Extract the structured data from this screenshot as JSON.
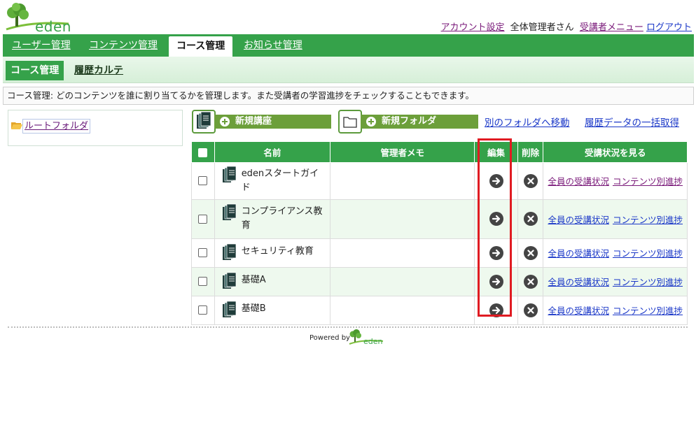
{
  "header": {
    "logo_text": "eden",
    "account_settings": "アカウント設定",
    "user_name": "全体管理者さん",
    "learner_menu": "受講者メニュー",
    "logout": "ログアウト"
  },
  "main_tabs": [
    {
      "label": "ユーザー管理"
    },
    {
      "label": "コンテンツ管理"
    },
    {
      "label": "コース管理"
    },
    {
      "label": "お知らせ管理"
    }
  ],
  "sub_tabs": {
    "active": "コース管理",
    "history": "履歴カルテ"
  },
  "description": "コース管理: どのコンテンツを誰に割り当てるかを管理します。また受講者の学習進捗をチェックすることもできます。",
  "folder_tree": {
    "root_label": "ルートフォルダ"
  },
  "toolbar": {
    "new_course": "新規講座",
    "new_folder": "新規フォルダ",
    "move_folder": "別のフォルダへ移動",
    "history_bulk": "履歴データの一括取得"
  },
  "table": {
    "headers": {
      "name": "名前",
      "memo": "管理者メモ",
      "edit": "編集",
      "delete": "削除",
      "status": "受講状況を見る"
    },
    "rows": [
      {
        "name": "edenスタートガイド",
        "memo": "",
        "all_status": "全員の受講状況",
        "content_progress": "コンテンツ別進捗"
      },
      {
        "name": "コンプライアンス教育",
        "memo": "",
        "all_status": "全員の受講状況",
        "content_progress": "コンテンツ別進捗"
      },
      {
        "name": "セキュリティ教育",
        "memo": "",
        "all_status": "全員の受講状況",
        "content_progress": "コンテンツ別進捗"
      },
      {
        "name": "基礎A",
        "memo": "",
        "all_status": "全員の受講状況",
        "content_progress": "コンテンツ別進捗"
      },
      {
        "name": "基礎B",
        "memo": "",
        "all_status": "全員の受講状況",
        "content_progress": "コンテンツ別進捗"
      }
    ]
  },
  "footer": {
    "powered_by": "Powered by",
    "logo_text": "eden"
  },
  "colors": {
    "brand_green": "#35a24a",
    "highlight_red": "#e01b22"
  }
}
